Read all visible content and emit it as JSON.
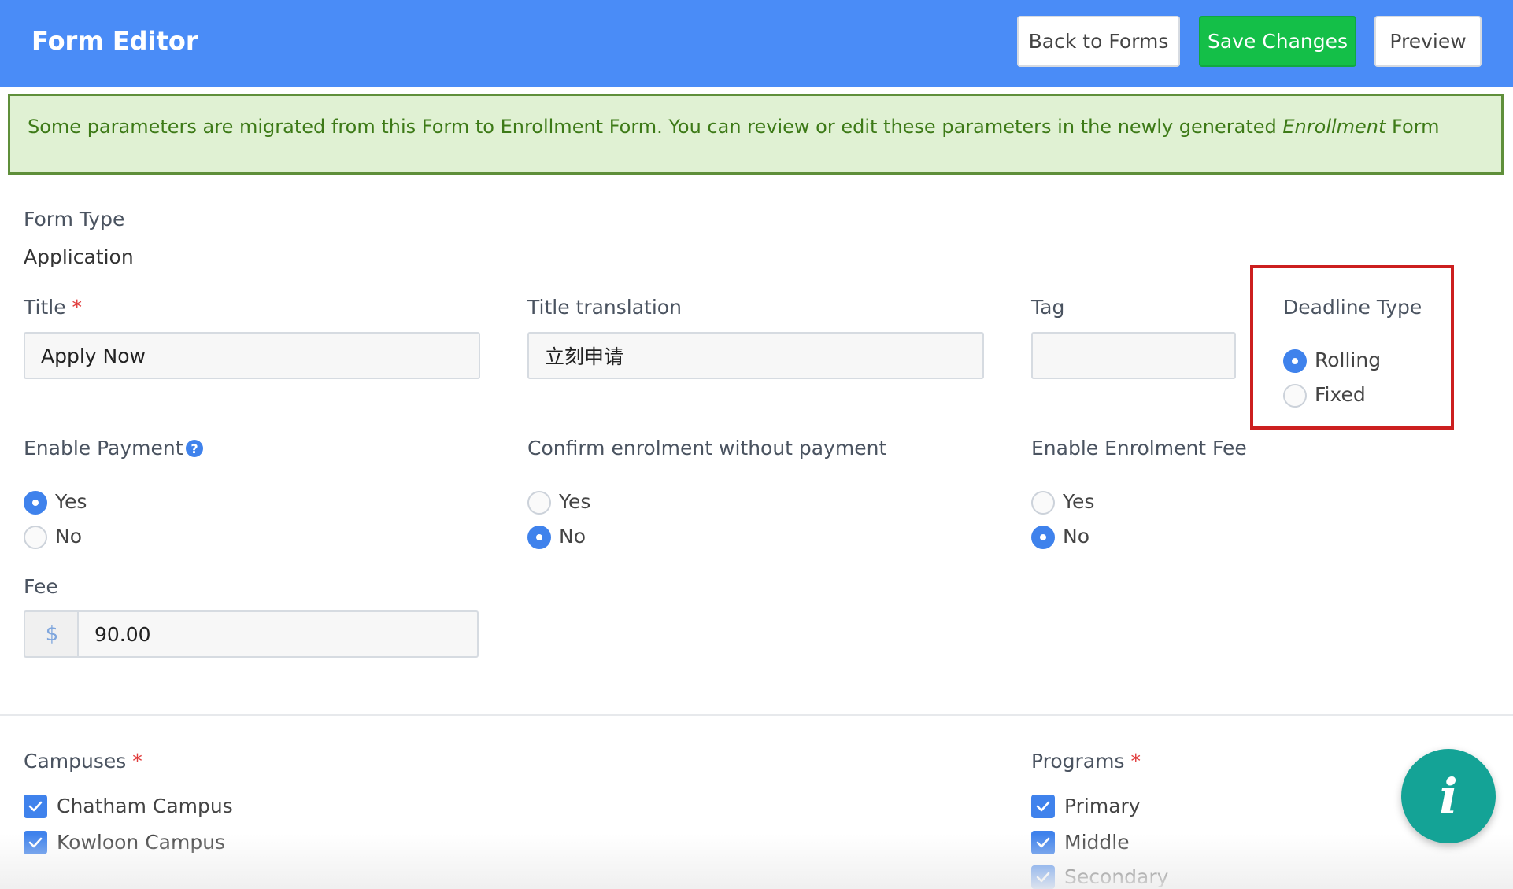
{
  "header": {
    "title": "Form Editor",
    "back_label": "Back to Forms",
    "save_label": "Save Changes",
    "preview_label": "Preview"
  },
  "alert": {
    "text_before": "Some parameters are migrated from this Form to Enrollment Form. You can review or edit these parameters in the newly generated ",
    "emphasis": "Enrollment",
    "text_after": " Form"
  },
  "form_type": {
    "label": "Form Type",
    "value": "Application"
  },
  "title_field": {
    "label": "Title",
    "required_mark": "*",
    "value": "Apply Now"
  },
  "title_translation": {
    "label": "Title translation",
    "value": "立刻申请"
  },
  "tag": {
    "label": "Tag",
    "value": ""
  },
  "deadline_type": {
    "label": "Deadline Type",
    "options": [
      {
        "label": "Rolling",
        "selected": true
      },
      {
        "label": "Fixed",
        "selected": false
      }
    ]
  },
  "enable_payment": {
    "label": "Enable Payment",
    "help_icon": "?",
    "options": [
      {
        "label": "Yes",
        "selected": true
      },
      {
        "label": "No",
        "selected": false
      }
    ]
  },
  "confirm_without_payment": {
    "label": "Confirm enrolment without payment",
    "options": [
      {
        "label": "Yes",
        "selected": false
      },
      {
        "label": "No",
        "selected": true
      }
    ]
  },
  "enable_enrolment_fee": {
    "label": "Enable Enrolment Fee",
    "options": [
      {
        "label": "Yes",
        "selected": false
      },
      {
        "label": "No",
        "selected": true
      }
    ]
  },
  "fee": {
    "label": "Fee",
    "currency": "$",
    "value": "90.00"
  },
  "campuses": {
    "label": "Campuses",
    "required_mark": "*",
    "items": [
      {
        "label": "Chatham Campus",
        "checked": true
      },
      {
        "label": "Kowloon Campus",
        "checked": true
      }
    ]
  },
  "programs": {
    "label": "Programs",
    "required_mark": "*",
    "items": [
      {
        "label": "Primary",
        "checked": true
      },
      {
        "label": "Middle",
        "checked": true
      },
      {
        "label": "Secondary",
        "checked": true
      }
    ]
  },
  "fab": {
    "glyph": "i"
  },
  "colors": {
    "header": "#4a8cf7",
    "save_button": "#14bf48",
    "alert_bg": "#e0f1d3",
    "alert_text": "#3d7a17",
    "accent": "#3f82ec",
    "highlight_border": "#cc1f1f",
    "fab": "#14a396"
  },
  "icons": {
    "help": "question-circle-icon",
    "check": "check-icon",
    "info": "info-icon",
    "currency": "dollar-icon"
  }
}
